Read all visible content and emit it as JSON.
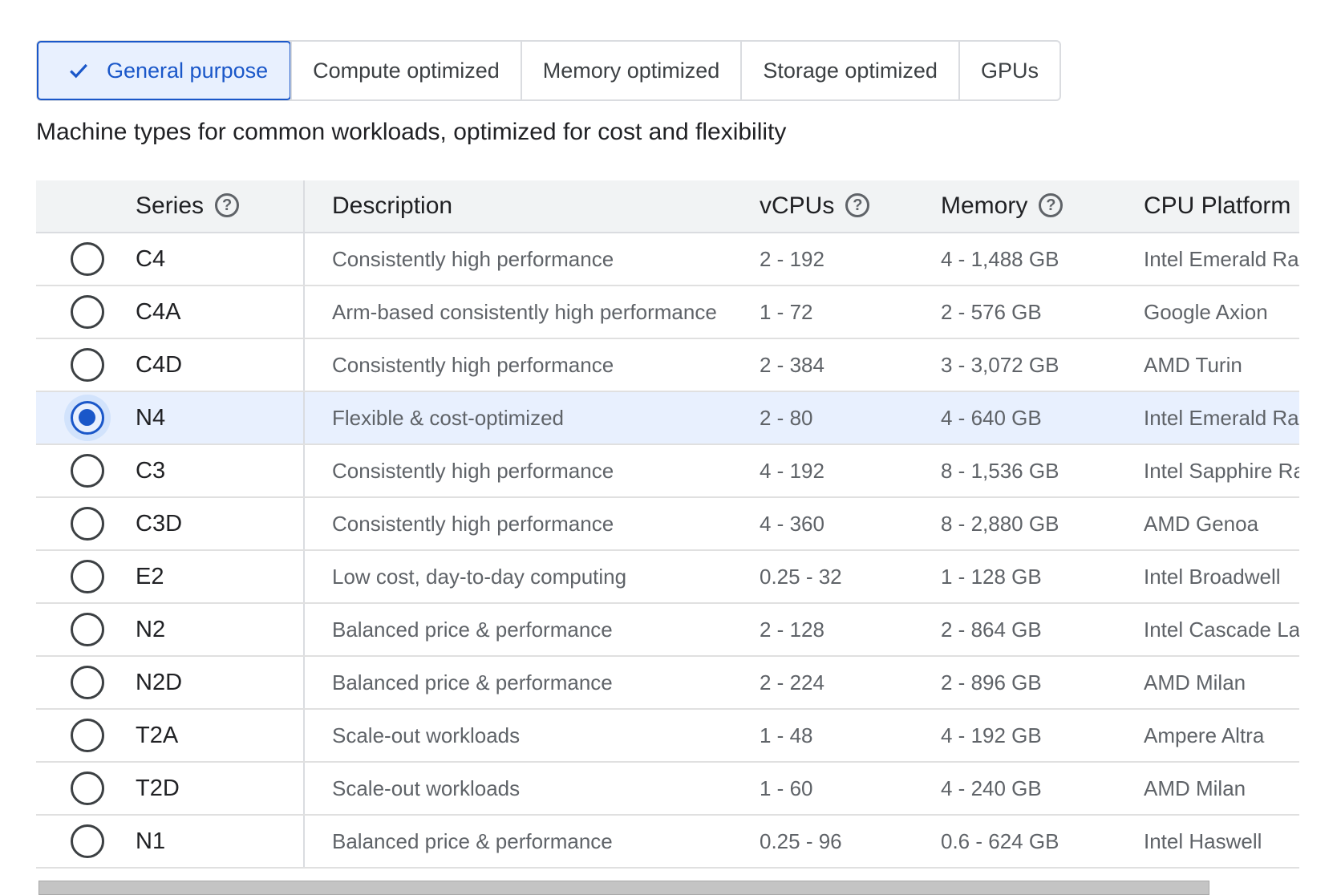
{
  "tabs": [
    {
      "label": "General purpose",
      "selected": true
    },
    {
      "label": "Compute optimized",
      "selected": false
    },
    {
      "label": "Memory optimized",
      "selected": false
    },
    {
      "label": "Storage optimized",
      "selected": false
    },
    {
      "label": "GPUs",
      "selected": false
    }
  ],
  "subtitle": "Machine types for common workloads, optimized for cost and flexibility",
  "table": {
    "headers": {
      "series": "Series",
      "description": "Description",
      "vcpus": "vCPUs",
      "memory": "Memory",
      "cpu_platform": "CPU Platform"
    },
    "help_icon_glyph": "?",
    "selected_series": "N4",
    "rows": [
      {
        "series": "C4",
        "description": "Consistently high performance",
        "vcpus": "2 - 192",
        "memory": "4 - 1,488 GB",
        "cpu": "Intel Emerald Rapids"
      },
      {
        "series": "C4A",
        "description": "Arm-based consistently high performance",
        "vcpus": "1 - 72",
        "memory": "2 - 576 GB",
        "cpu": "Google Axion"
      },
      {
        "series": "C4D",
        "description": "Consistently high performance",
        "vcpus": "2 - 384",
        "memory": "3 - 3,072 GB",
        "cpu": "AMD Turin"
      },
      {
        "series": "N4",
        "description": "Flexible & cost-optimized",
        "vcpus": "2 - 80",
        "memory": "4 - 640 GB",
        "cpu": "Intel Emerald Rapids"
      },
      {
        "series": "C3",
        "description": "Consistently high performance",
        "vcpus": "4 - 192",
        "memory": "8 - 1,536 GB",
        "cpu": "Intel Sapphire Rapids"
      },
      {
        "series": "C3D",
        "description": "Consistently high performance",
        "vcpus": "4 - 360",
        "memory": "8 - 2,880 GB",
        "cpu": "AMD Genoa"
      },
      {
        "series": "E2",
        "description": "Low cost, day-to-day computing",
        "vcpus": "0.25 - 32",
        "memory": "1 - 128 GB",
        "cpu": "Intel Broadwell"
      },
      {
        "series": "N2",
        "description": "Balanced price & performance",
        "vcpus": "2 - 128",
        "memory": "2 - 864 GB",
        "cpu": "Intel Cascade Lake"
      },
      {
        "series": "N2D",
        "description": "Balanced price & performance",
        "vcpus": "2 - 224",
        "memory": "2 - 896 GB",
        "cpu": "AMD Milan"
      },
      {
        "series": "T2A",
        "description": "Scale-out workloads",
        "vcpus": "1 - 48",
        "memory": "4 - 192 GB",
        "cpu": "Ampere Altra"
      },
      {
        "series": "T2D",
        "description": "Scale-out workloads",
        "vcpus": "1 - 60",
        "memory": "4 - 240 GB",
        "cpu": "AMD Milan"
      },
      {
        "series": "N1",
        "description": "Balanced price & performance",
        "vcpus": "0.25 - 96",
        "memory": "0.6 - 624 GB",
        "cpu": "Intel Haswell"
      }
    ]
  },
  "colors": {
    "accent": "#1a57c9",
    "selected_bg": "#e8f0fe",
    "header_bg": "#f1f3f4"
  }
}
